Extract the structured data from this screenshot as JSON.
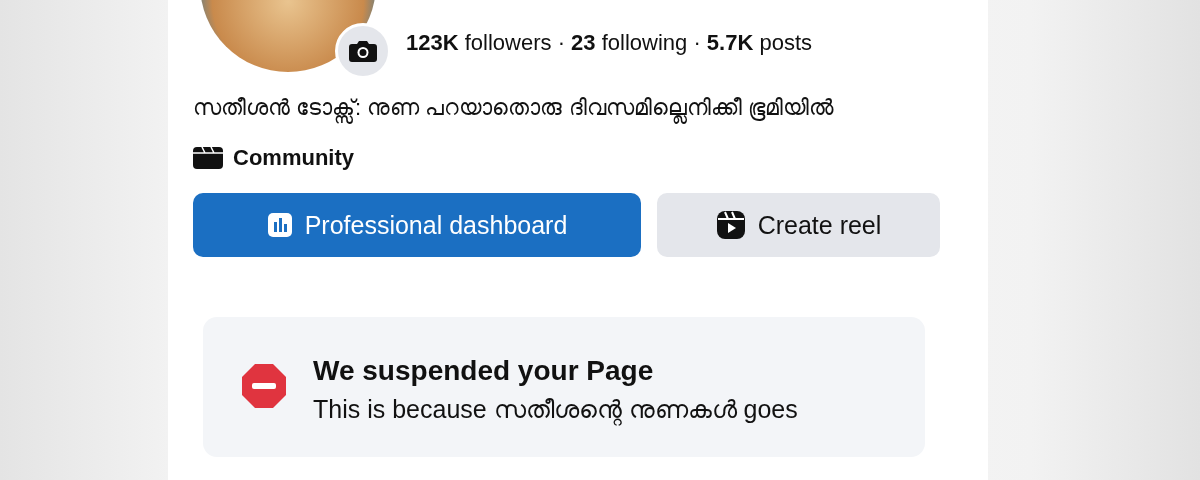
{
  "profile": {
    "stats": "**123K** followers · **23** following · **5.7K** posts",
    "bio": "സതീശൻ ടോക്സ്: നുണ പറയാതൊരു ദിവസമില്ലെനിക്കീ ഭൂമിയിൽ",
    "category": "Community"
  },
  "buttons": [
    {
      "kind": "primary",
      "label": "Professional dashboard"
    },
    {
      "kind": "secondary",
      "label": "Create reel"
    }
  ],
  "notice": {
    "title": "We suspended your Page",
    "body": "This is because സതീശന്റെ നുണകൾ goes"
  }
}
